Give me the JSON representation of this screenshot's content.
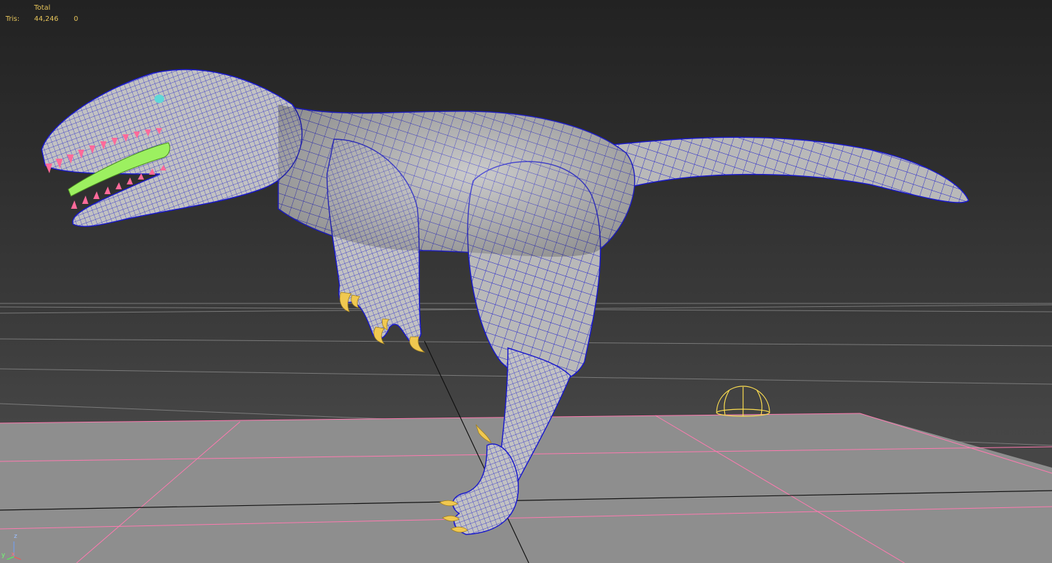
{
  "stats": {
    "header": "Total",
    "tris_label": "Tris:",
    "tris_total": "44,246",
    "tris_selected": "0"
  },
  "gizmo": {
    "z_label": "z",
    "x_label": "x",
    "y_label": "y"
  },
  "colors": {
    "wireframe": "#1a1acc",
    "grid": "#ff7ab0",
    "ground": "#8e8e8e",
    "claws": "#f0c850",
    "teeth": "#ff6a9a",
    "tongue": "#9cf060",
    "eye": "#60d8d8",
    "light": "#ffe050",
    "stats_text": "#e6c45a"
  },
  "viewport": {
    "object": "dinosaur mesh",
    "light_icon": "omni-light-icon"
  }
}
